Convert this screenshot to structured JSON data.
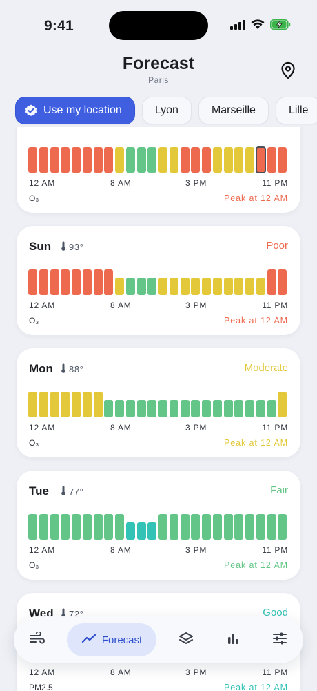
{
  "status": {
    "time": "9:41"
  },
  "header": {
    "title": "Forecast",
    "subtitle": "Paris"
  },
  "chips": [
    {
      "label": "Use my location",
      "active": true
    },
    {
      "label": "Lyon"
    },
    {
      "label": "Marseille"
    },
    {
      "label": "Lille"
    }
  ],
  "colors": {
    "poor": "#ee6a4e",
    "moderate": "#e3c93a",
    "fair": "#63c587",
    "good": "#33c2b6",
    "accent": "#3f5fe0"
  },
  "time_labels": [
    "12 AM",
    "8 AM",
    "3 PM",
    "11 PM"
  ],
  "days": [
    {
      "day": "",
      "temp": "",
      "status": "",
      "status_level": "",
      "pollutant": "O₃",
      "peak": "Peak at 12 AM",
      "peak_level": "poor",
      "hours": [
        "poor",
        "poor",
        "poor",
        "poor",
        "poor",
        "poor",
        "poor",
        "poor",
        "moderate",
        "fair",
        "fair",
        "fair",
        "moderate",
        "moderate",
        "poor",
        "poor",
        "poor",
        "moderate",
        "moderate",
        "moderate",
        "moderate",
        "poor",
        "poor",
        "poor"
      ],
      "selected_hour": 21
    },
    {
      "day": "Sun",
      "temp": "93°",
      "status": "Poor",
      "status_level": "poor",
      "pollutant": "O₃",
      "peak": "Peak at 12 AM",
      "peak_level": "poor",
      "hours": [
        "poor",
        "poor",
        "poor",
        "poor",
        "poor",
        "poor",
        "poor",
        "poor",
        "moderate",
        "fair",
        "fair",
        "fair",
        "moderate",
        "moderate",
        "moderate",
        "moderate",
        "moderate",
        "moderate",
        "moderate",
        "moderate",
        "moderate",
        "moderate",
        "poor",
        "poor"
      ],
      "small_hours": [
        8,
        9,
        10,
        11,
        12,
        13,
        14,
        15,
        16,
        17,
        18,
        19,
        20,
        21
      ]
    },
    {
      "day": "Mon",
      "temp": "88°",
      "status": "Moderate",
      "status_level": "moderate",
      "pollutant": "O₃",
      "peak": "Peak at 12 AM",
      "peak_level": "moderate",
      "hours": [
        "moderate",
        "moderate",
        "moderate",
        "moderate",
        "moderate",
        "moderate",
        "moderate",
        "fair",
        "fair",
        "fair",
        "fair",
        "fair",
        "fair",
        "fair",
        "fair",
        "fair",
        "fair",
        "fair",
        "fair",
        "fair",
        "fair",
        "fair",
        "fair",
        "moderate"
      ],
      "small_hours": [
        7,
        8,
        9,
        10,
        11,
        12,
        13,
        14,
        15,
        16,
        17,
        18,
        19,
        20,
        21,
        22
      ]
    },
    {
      "day": "Tue",
      "temp": "77°",
      "status": "Fair",
      "status_level": "fair",
      "pollutant": "O₃",
      "peak": "Peak at 12 AM",
      "peak_level": "fair",
      "hours": [
        "fair",
        "fair",
        "fair",
        "fair",
        "fair",
        "fair",
        "fair",
        "fair",
        "fair",
        "good",
        "good",
        "good",
        "fair",
        "fair",
        "fair",
        "fair",
        "fair",
        "fair",
        "fair",
        "fair",
        "fair",
        "fair",
        "fair",
        "fair"
      ],
      "small_hours": [
        9,
        10,
        11
      ]
    },
    {
      "day": "Wed",
      "temp": "72°",
      "status": "Good",
      "status_level": "good",
      "pollutant": "PM2.5",
      "peak": "Peak at 12 AM",
      "peak_level": "good",
      "hours": [],
      "small_hours": []
    }
  ],
  "tabbar": {
    "forecast_label": "Forecast"
  }
}
